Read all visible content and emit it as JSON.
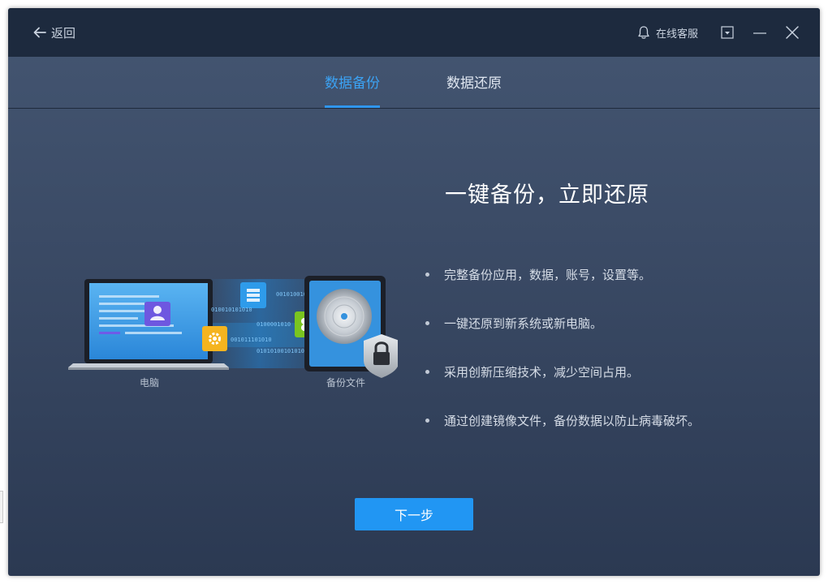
{
  "titlebar": {
    "back_label": "返回",
    "service_label": "在线客服"
  },
  "tabs": [
    {
      "label": "数据备份",
      "active": true
    },
    {
      "label": "数据还原",
      "active": false
    }
  ],
  "main": {
    "headline": "一键备份，立即还原",
    "features": [
      "完整备份应用，数据，账号，设置等。",
      "一键还原到新系统或新电脑。",
      "采用创新压缩技术，减少空间占用。",
      "通过创建镜像文件，备份数据以防止病毒破坏。"
    ],
    "illustration": {
      "source_label": "电脑",
      "target_label": "备份文件",
      "binary_text": [
        "0010100100",
        "010010101010",
        "0100001010",
        "001011101010",
        "01010100101010"
      ]
    },
    "next_button": "下一步"
  },
  "colors": {
    "accent": "#2196f3",
    "active_tab": "#3ba3f5",
    "titlebar": "#1d2a3e"
  },
  "icons": {
    "back": "arrow-left-icon",
    "service": "bell-icon",
    "menu": "dropdown-menu-icon",
    "minimize": "minimize-icon",
    "close": "close-icon"
  }
}
